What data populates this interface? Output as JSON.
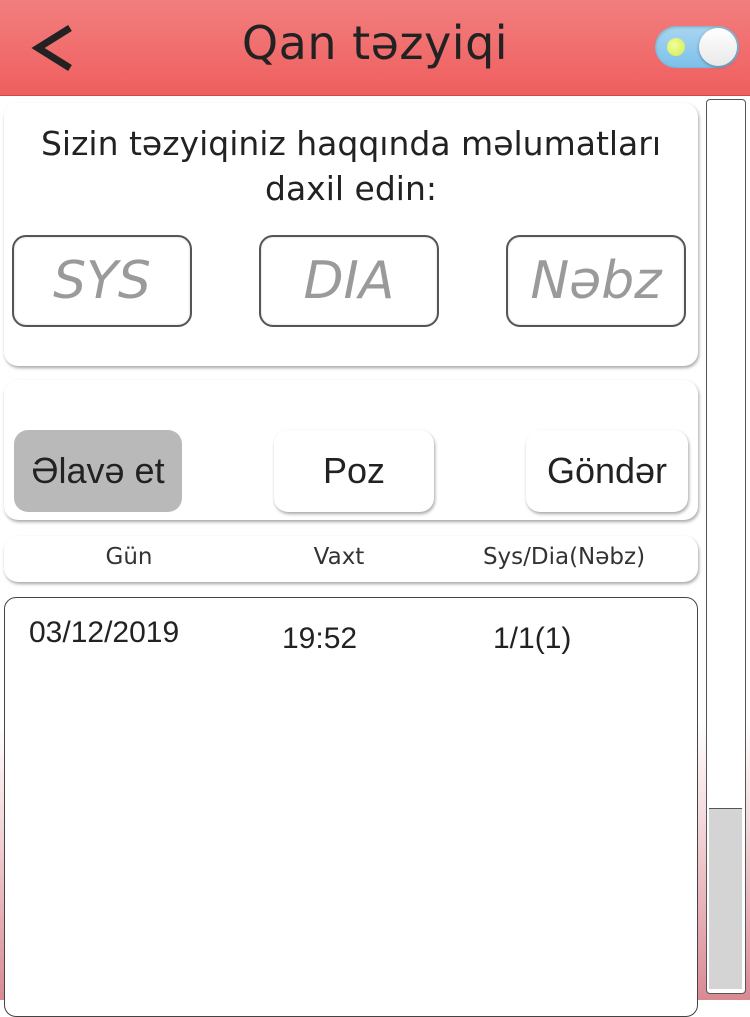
{
  "header": {
    "title": "Qan təzyiqi",
    "back_icon": "chevron-left-icon",
    "toggle_state": "on",
    "colors": {
      "bar": "#ef6a6a",
      "toggle": "#7cc0ea"
    }
  },
  "input_panel": {
    "intro": "Sizin təzyiqiniz haqqında məlumatları daxil edin:",
    "sys_placeholder": "SYS",
    "dia_placeholder": "DIA",
    "pulse_placeholder": "Nəbz"
  },
  "actions": {
    "add_label": "Əlavə et",
    "delete_label": "Poz",
    "send_label": "Göndər"
  },
  "table": {
    "columns": [
      "Gün",
      "Vaxt",
      "Sys/Dia(Nəbz)"
    ],
    "rows": [
      {
        "date": "03/12/2019",
        "time": "19:52",
        "value": "1/1(1)"
      }
    ]
  }
}
